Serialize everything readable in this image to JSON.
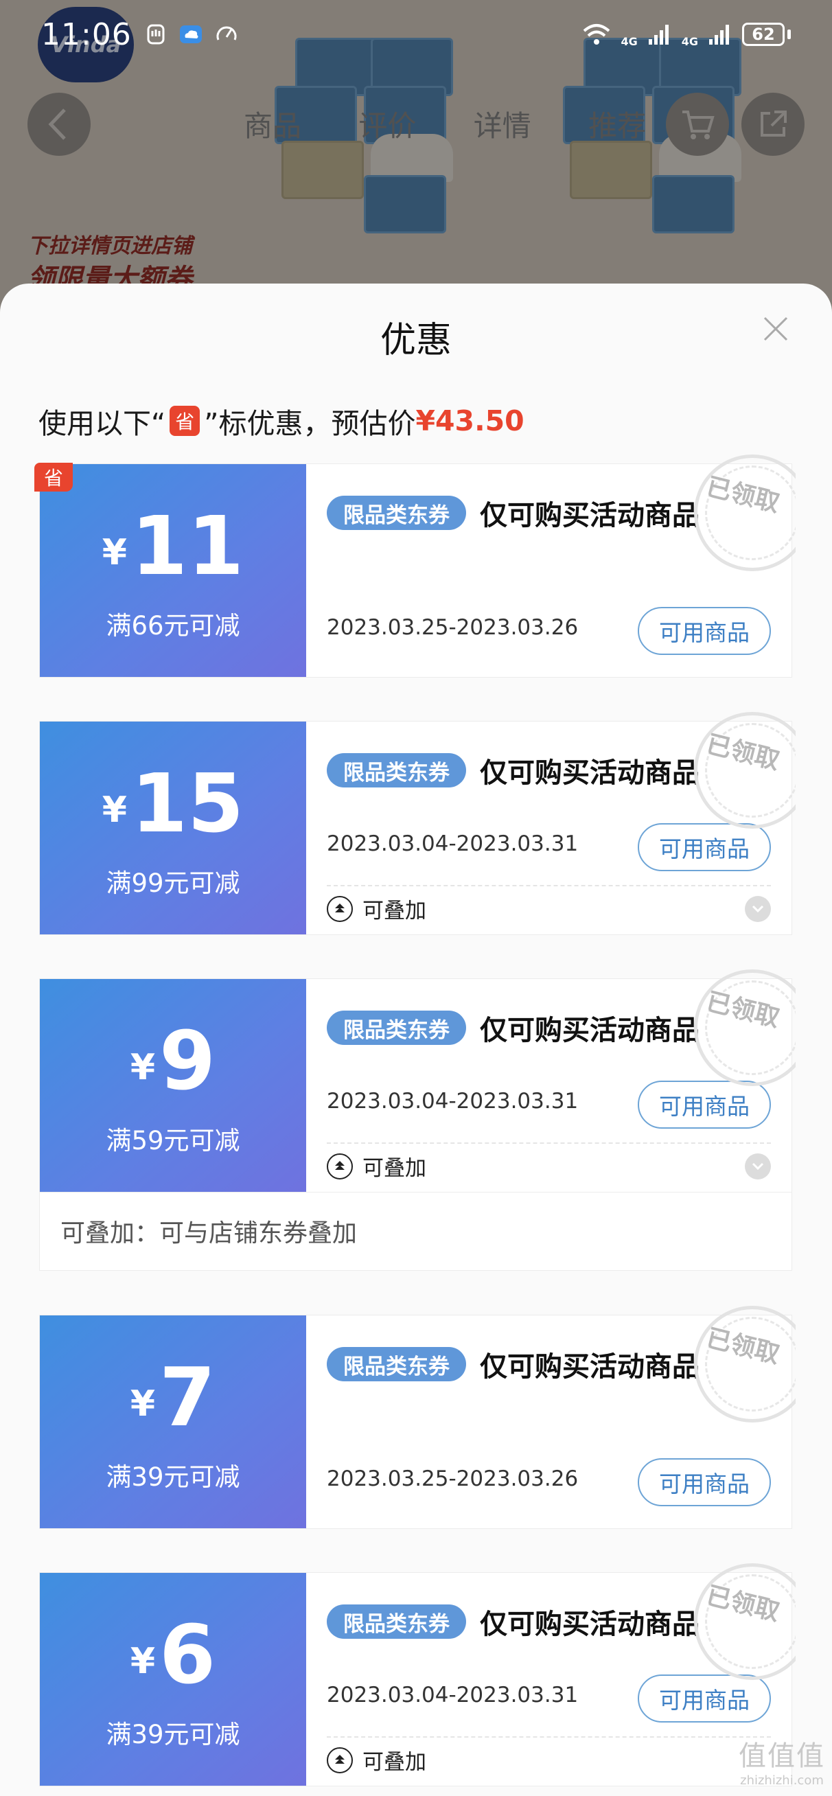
{
  "status_bar": {
    "time": "11:06",
    "battery": "62",
    "network_1": "4G",
    "network_2": "4G",
    "icons": [
      "hand-icon",
      "cloud-icon",
      "speedometer-icon",
      "wifi-icon",
      "signal-icon",
      "signal-icon",
      "battery-icon"
    ]
  },
  "background_page": {
    "logo_text": "Vinda",
    "tabs": [
      "商品",
      "评价",
      "详情",
      "推荐"
    ],
    "promo_line1": "下拉详情页进店铺",
    "promo_line2": "领限量大额券"
  },
  "sheet": {
    "title": "优惠",
    "summary_prefix": "使用以下“",
    "summary_badge": "省",
    "summary_suffix": "”标优惠，预估价",
    "estimated_price": "¥43.50"
  },
  "coupons": [
    {
      "currency": "¥",
      "amount": "11",
      "condition": "满66元可减",
      "badge": "省",
      "tag": "限品类东券",
      "description": "仅可购买活动商品",
      "date": "2023.03.25-2023.03.26",
      "button": "可用商品",
      "stamp": "已领取"
    },
    {
      "currency": "¥",
      "amount": "15",
      "condition": "满99元可减",
      "tag": "限品类东券",
      "description": "仅可购买活动商品",
      "date": "2023.03.04-2023.03.31",
      "button": "可用商品",
      "stamp": "已领取",
      "stack_label": "可叠加"
    },
    {
      "currency": "¥",
      "amount": "9",
      "condition": "满59元可减",
      "tag": "限品类东券",
      "description": "仅可购买活动商品",
      "date": "2023.03.04-2023.03.31",
      "button": "可用商品",
      "stamp": "已领取",
      "stack_label": "可叠加",
      "expanded_note": "可叠加：可与店铺东券叠加"
    },
    {
      "currency": "¥",
      "amount": "7",
      "condition": "满39元可减",
      "tag": "限品类东券",
      "description": "仅可购买活动商品",
      "date": "2023.03.25-2023.03.26",
      "button": "可用商品",
      "stamp": "已领取"
    },
    {
      "currency": "¥",
      "amount": "6",
      "condition": "满39元可减",
      "tag": "限品类东券",
      "description": "仅可购买活动商品",
      "date": "2023.03.04-2023.03.31",
      "button": "可用商品",
      "stamp": "已领取",
      "stack_label": "可叠加"
    }
  ],
  "watermark": {
    "main": "值值值",
    "sub": "zhizhizhi.com"
  },
  "colors": {
    "accent_red": "#e8442e",
    "coupon_blue": "#5f97d9",
    "button_blue": "#3d7fc4"
  }
}
